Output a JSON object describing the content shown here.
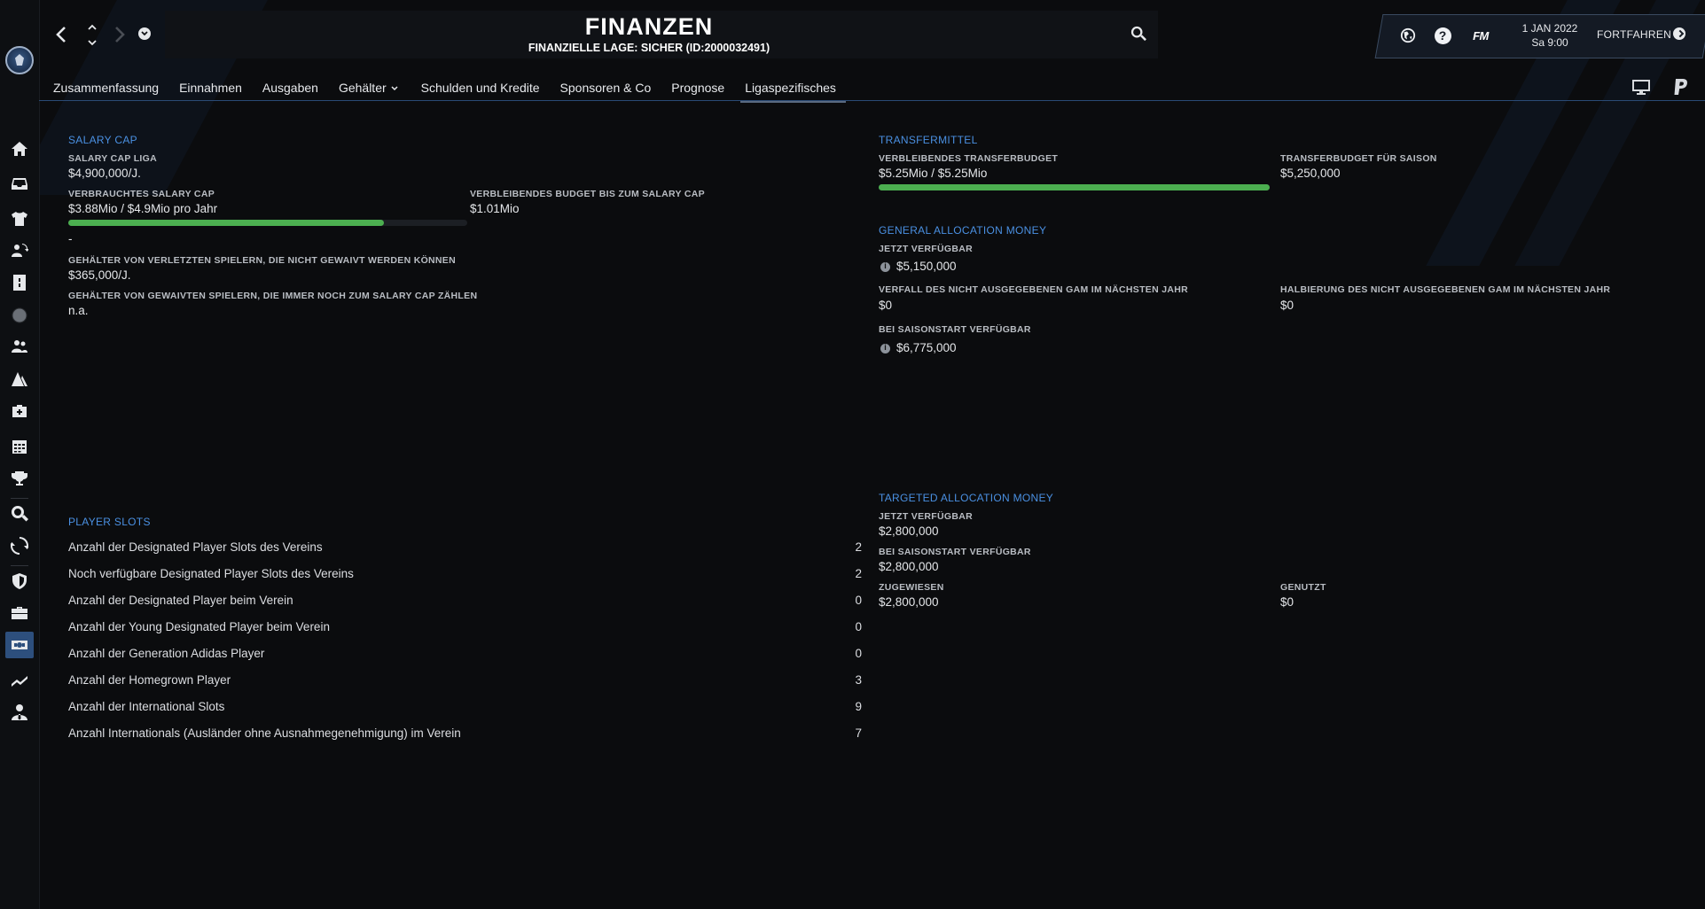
{
  "header": {
    "title": "FINANZEN",
    "subtitle": "FINANZIELLE LAGE: SICHER (ID:2000032491)"
  },
  "status": {
    "date_line1": "1 JAN 2022",
    "date_line2": "Sa 9:00",
    "fm_label": "FM",
    "help_label": "?",
    "continue_label": "FORTFAHREN"
  },
  "tabs": [
    {
      "label": "Zusammenfassung"
    },
    {
      "label": "Einnahmen"
    },
    {
      "label": "Ausgaben"
    },
    {
      "label": "Gehälter"
    },
    {
      "label": "Schulden und Kredite"
    },
    {
      "label": "Sponsoren & Co"
    },
    {
      "label": "Prognose"
    },
    {
      "label": "Ligaspezifisches"
    }
  ],
  "salary_cap": {
    "title": "SALARY CAP",
    "league_label": "SALARY CAP LIGA",
    "league_value": "$4,900,000/J.",
    "used_label": "VERBRAUCHTES SALARY CAP",
    "used_value": "$3.88Mio / $4.9Mio pro Jahr",
    "used_fraction": 0.79,
    "remaining_label": "VERBLEIBENDES BUDGET BIS ZUM SALARY CAP",
    "remaining_value": "$1.01Mio",
    "dash": "-",
    "injured_label": "GEHÄLTER VON VERLETZTEN SPIELERN, DIE NICHT GEWAIVT WERDEN KÖNNEN",
    "injured_value": "$365,000/J.",
    "waived_label": "GEHÄLTER VON GEWAIVTEN SPIELERN, DIE IMMER NOCH ZUM SALARY CAP ZÄHLEN",
    "waived_value": "n.a."
  },
  "transfer": {
    "title": "TRANSFERMITTEL",
    "remaining_label": "VERBLEIBENDES TRANSFERBUDGET",
    "remaining_value": "$5.25Mio / $5.25Mio",
    "remaining_fraction": 1.0,
    "season_label": "TRANSFERBUDGET FÜR SAISON",
    "season_value": "$5,250,000"
  },
  "gam": {
    "title": "GENERAL ALLOCATION MONEY",
    "now_label": "JETZT VERFÜGBAR",
    "now_value": "$5,150,000",
    "expire_label": "VERFALL DES NICHT AUSGEGEBENEN GAM IM NÄCHSTEN JAHR",
    "expire_value": "$0",
    "halve_label": "HALBIERUNG DES NICHT AUSGEGEBENEN GAM IM NÄCHSTEN JAHR",
    "halve_value": "$0",
    "season_label": "BEI SAISONSTART VERFÜGBAR",
    "season_value": "$6,775,000"
  },
  "tam": {
    "title": "TARGETED ALLOCATION MONEY",
    "now_label": "JETZT VERFÜGBAR",
    "now_value": "$2,800,000",
    "season_label": "BEI SAISONSTART VERFÜGBAR",
    "season_value": "$2,800,000",
    "assigned_label": "ZUGEWIESEN",
    "assigned_value": "$2,800,000",
    "used_label": "GENUTZT",
    "used_value": "$0"
  },
  "player_slots": {
    "title": "PLAYER SLOTS",
    "rows": [
      {
        "label": "Anzahl der Designated Player Slots des Vereins",
        "value": "2"
      },
      {
        "label": "Noch verfügbare Designated Player Slots des Vereins",
        "value": "2"
      },
      {
        "label": "Anzahl der Designated Player beim Verein",
        "value": "0"
      },
      {
        "label": "Anzahl der Young Designated Player beim Verein",
        "value": "0"
      },
      {
        "label": "Anzahl der Generation Adidas Player",
        "value": "0"
      },
      {
        "label": "Anzahl der Homegrown Player",
        "value": "3"
      },
      {
        "label": "Anzahl der International Slots",
        "value": "9"
      },
      {
        "label": "Anzahl Internationals (Ausländer ohne Ausnahmegenehmigung) im Verein",
        "value": "7"
      }
    ]
  }
}
